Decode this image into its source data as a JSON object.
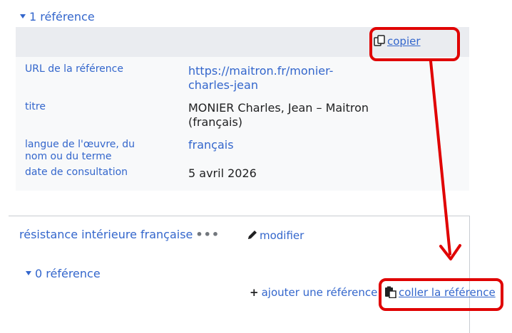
{
  "reference": {
    "count_label": "1 référence",
    "copy_label": "copier",
    "rows": [
      {
        "property": "URL de la référence",
        "value": "https://maitron.fr/monier-charles-jean",
        "value_lines": [
          "https://maitron.fr/monier-",
          "charles-jean"
        ],
        "is_link": true
      },
      {
        "property": "titre",
        "value_lines": [
          "MONIER Charles, Jean – Maitron",
          "(français)"
        ],
        "is_link": false
      },
      {
        "property_lines": [
          "langue de l'œuvre, du",
          "nom ou du terme"
        ],
        "value_lines": [
          "français"
        ],
        "is_link": true
      },
      {
        "property": "date de consultation",
        "value_lines": [
          "5 avril 2026"
        ],
        "is_link": false
      }
    ]
  },
  "statement": {
    "value": "résistance intérieure française",
    "menu_dots": "•••",
    "edit_label": "modifier",
    "references_label": "0 référence",
    "add_reference_label": "ajouter une référence",
    "paste_reference_label": "coller la référence"
  },
  "colors": {
    "link": "#3366cc",
    "highlight": "#e00000",
    "reference_bg": "#f8f9fa",
    "reference_header_bg": "#eaecf0"
  },
  "icons": [
    "triangle-down-icon",
    "copy-icon",
    "pencil-icon",
    "plus-icon",
    "paste-icon"
  ]
}
